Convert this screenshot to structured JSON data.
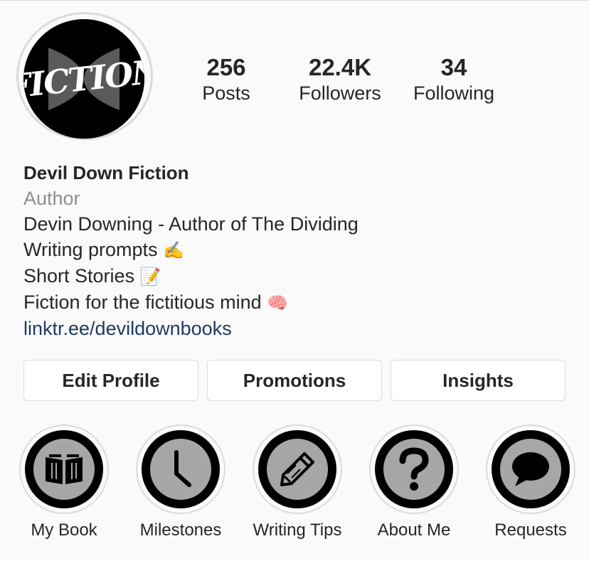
{
  "profile": {
    "avatar_text": "FICTION",
    "stats": {
      "posts": {
        "value": "256",
        "label": "Posts"
      },
      "followers": {
        "value": "22.4K",
        "label": "Followers"
      },
      "following": {
        "value": "34",
        "label": "Following"
      }
    },
    "name": "Devil Down Fiction",
    "category": "Author",
    "bio_lines": [
      {
        "text": "Devin Downing - Author of The Dividing",
        "emoji": ""
      },
      {
        "text": "Writing prompts",
        "emoji": "✍️"
      },
      {
        "text": "Short Stories",
        "emoji": "📝"
      },
      {
        "text": "Fiction for the fictitious mind",
        "emoji": "🧠"
      }
    ],
    "link": "linktr.ee/devildownbooks"
  },
  "buttons": {
    "edit_profile": "Edit Profile",
    "promotions": "Promotions",
    "insights": "Insights"
  },
  "highlights": [
    {
      "label": "My Book",
      "icon": "book-icon"
    },
    {
      "label": "Milestones",
      "icon": "clock-icon"
    },
    {
      "label": "Writing Tips",
      "icon": "pencil-icon"
    },
    {
      "label": "About Me",
      "icon": "question-icon"
    },
    {
      "label": "Requests",
      "icon": "speech-bubble-icon"
    }
  ],
  "colors": {
    "background": "#fafafa",
    "text": "#262626",
    "secondary_text": "#8e8e8e",
    "link": "#1e3a62",
    "border": "#dbdbdb",
    "highlight_inner": "#a6a6a6"
  }
}
